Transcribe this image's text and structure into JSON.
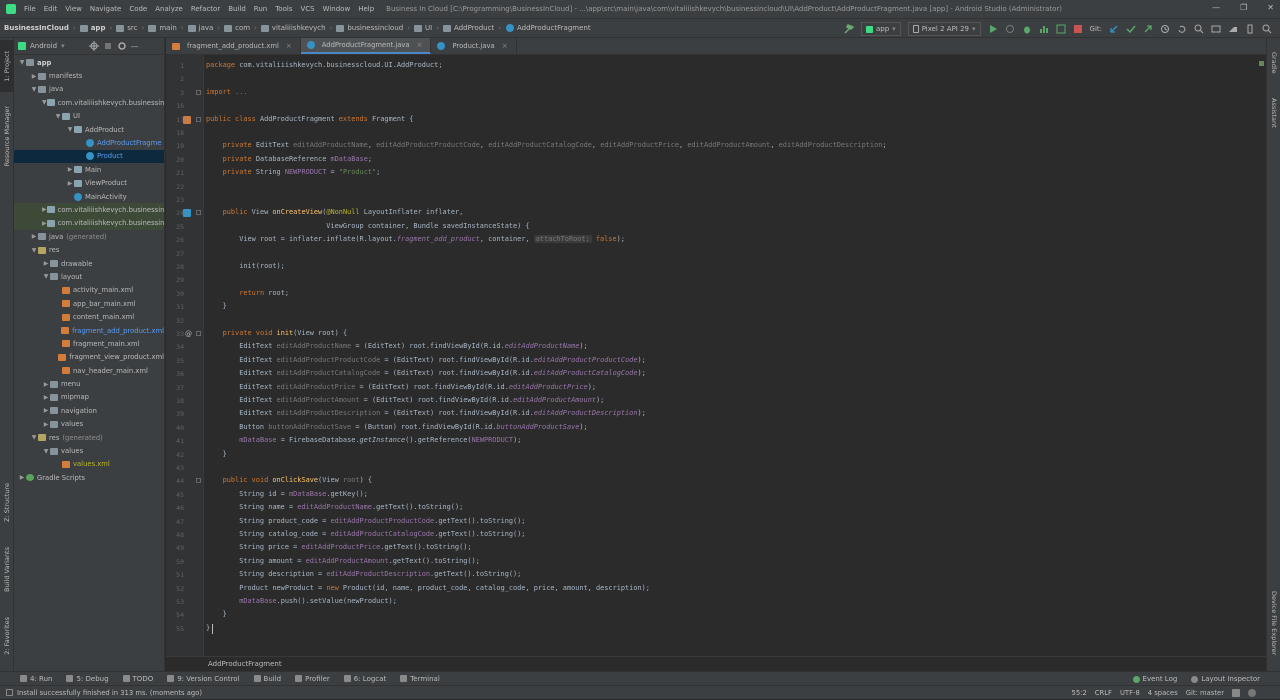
{
  "menubar": {
    "items": [
      "File",
      "Edit",
      "View",
      "Navigate",
      "Code",
      "Analyze",
      "Refactor",
      "Build",
      "Run",
      "Tools",
      "VCS",
      "Window",
      "Help"
    ],
    "window_title": "Business In Cloud [C:\\Programming\\BusinessInCloud] - ...\\app\\src\\main\\java\\com\\vitaliiishkevych\\businessincloud\\UI\\AddProduct\\AddProductFragment.java [app] - Android Studio (Administrator)",
    "win_min": "—",
    "win_max": "❐",
    "win_close": "✕"
  },
  "breadcrumbs": {
    "project": "BusinessInCloud",
    "items": [
      "app",
      "src",
      "main",
      "java",
      "com",
      "vitaliiishkevych",
      "businessincloud",
      "UI",
      "AddProduct",
      "AddProductFragment"
    ]
  },
  "runbar": {
    "config": "app",
    "device": "Pixel 2 API 29",
    "git": "Git:"
  },
  "left_tabs": {
    "project": "1: Project",
    "resource_manager": "Resource Manager",
    "structure": "Z: Structure",
    "build_variants": "Build Variants",
    "favorites": "2: Favorites"
  },
  "right_tabs": {
    "gradle": "Gradle",
    "assistant": "Assistant",
    "device_explorer": "Device File Explorer"
  },
  "project_panel": {
    "view_mode": "Android",
    "tree": [
      {
        "label": "app",
        "level": 0,
        "arrow": "▼",
        "icon": "folder",
        "bold": true
      },
      {
        "label": "manifests",
        "level": 1,
        "arrow": "▶",
        "icon": "folder"
      },
      {
        "label": "java",
        "level": 1,
        "arrow": "▼",
        "icon": "folder"
      },
      {
        "label": "com.vitaliiishkevych.businessinc",
        "level": 2,
        "arrow": "▼",
        "icon": "pkg"
      },
      {
        "label": "UI",
        "level": 3,
        "arrow": "▼",
        "icon": "pkg"
      },
      {
        "label": "AddProduct",
        "level": 4,
        "arrow": "▼",
        "icon": "pkg"
      },
      {
        "label": "AddProductFragme",
        "level": 5,
        "arrow": "",
        "icon": "cls",
        "color": "blue"
      },
      {
        "label": "Product",
        "level": 5,
        "arrow": "",
        "icon": "cls",
        "color": "blue",
        "selected": true
      },
      {
        "label": "Main",
        "level": 4,
        "arrow": "▶",
        "icon": "pkg"
      },
      {
        "label": "ViewProduct",
        "level": 4,
        "arrow": "▶",
        "icon": "pkg"
      },
      {
        "label": "MainActivity",
        "level": 4,
        "arrow": "",
        "icon": "cls"
      },
      {
        "label": "com.vitaliiishkevych.businessinc",
        "level": 2,
        "arrow": "▶",
        "icon": "pkg",
        "highlight": true,
        "suffix": "(androidTest)"
      },
      {
        "label": "com.vitaliiishkevych.businessinc",
        "level": 2,
        "arrow": "▶",
        "icon": "pkg",
        "highlight": true,
        "suffix": "(test)"
      },
      {
        "label": "java",
        "level": 1,
        "arrow": "▶",
        "icon": "folder",
        "suffix": "(generated)"
      },
      {
        "label": "res",
        "level": 1,
        "arrow": "▼",
        "icon": "res"
      },
      {
        "label": "drawable",
        "level": 2,
        "arrow": "▶",
        "icon": "folder"
      },
      {
        "label": "layout",
        "level": 2,
        "arrow": "▼",
        "icon": "folder"
      },
      {
        "label": "activity_main.xml",
        "level": 3,
        "arrow": "",
        "icon": "xml"
      },
      {
        "label": "app_bar_main.xml",
        "level": 3,
        "arrow": "",
        "icon": "xml"
      },
      {
        "label": "content_main.xml",
        "level": 3,
        "arrow": "",
        "icon": "xml"
      },
      {
        "label": "fragment_add_product.xml",
        "level": 3,
        "arrow": "",
        "icon": "xml",
        "color": "blue"
      },
      {
        "label": "fragment_main.xml",
        "level": 3,
        "arrow": "",
        "icon": "xml"
      },
      {
        "label": "fragment_view_product.xml",
        "level": 3,
        "arrow": "",
        "icon": "xml"
      },
      {
        "label": "nav_header_main.xml",
        "level": 3,
        "arrow": "",
        "icon": "xml"
      },
      {
        "label": "menu",
        "level": 2,
        "arrow": "▶",
        "icon": "folder"
      },
      {
        "label": "mipmap",
        "level": 2,
        "arrow": "▶",
        "icon": "folder"
      },
      {
        "label": "navigation",
        "level": 2,
        "arrow": "▶",
        "icon": "folder"
      },
      {
        "label": "values",
        "level": 2,
        "arrow": "▶",
        "icon": "folder"
      },
      {
        "label": "res",
        "level": 1,
        "arrow": "▼",
        "icon": "res",
        "suffix": "(generated)"
      },
      {
        "label": "values",
        "level": 2,
        "arrow": "▼",
        "icon": "folder"
      },
      {
        "label": "values.xml",
        "level": 3,
        "arrow": "",
        "icon": "xml",
        "color": "yellow"
      },
      {
        "label": "Gradle Scripts",
        "level": 0,
        "arrow": "▶",
        "icon": "gradle"
      }
    ]
  },
  "editor_tabs": [
    {
      "label": "fragment_add_product.xml",
      "icon": "xml",
      "active": false
    },
    {
      "label": "AddProductFragment.java",
      "icon": "cls",
      "active": true
    },
    {
      "label": "Product.java",
      "icon": "cls",
      "active": false
    }
  ],
  "code": {
    "line_numbers": [
      "1",
      "2",
      "3",
      "16",
      "17",
      "18",
      "19",
      "20",
      "21",
      "22",
      "23",
      "24",
      "25",
      "26",
      "27",
      "28",
      "29",
      "30",
      "31",
      "32",
      "33",
      "34",
      "35",
      "36",
      "37",
      "38",
      "39",
      "40",
      "41",
      "42",
      "43",
      "44",
      "45",
      "46",
      "47",
      "48",
      "49",
      "50",
      "51",
      "52",
      "53",
      "54",
      "55"
    ],
    "lines": [
      [
        [
          "k",
          "package "
        ],
        [
          "",
          "com.vitaliiishkevych.businesscloud.UI.AddProduct;"
        ]
      ],
      [],
      [
        [
          "k",
          "import "
        ],
        [
          "g",
          "..."
        ]
      ],
      [],
      [
        [
          "k",
          "public class "
        ],
        [
          "",
          "AddProductFragment "
        ],
        [
          "k",
          "extends "
        ],
        [
          "",
          "Fragment {"
        ]
      ],
      [],
      [
        [
          "",
          "    "
        ],
        [
          "k",
          "private "
        ],
        [
          "",
          "EditText "
        ],
        [
          "g",
          "editAddProductName"
        ],
        [
          "",
          ", "
        ],
        [
          "g",
          "editAddProductProductCode"
        ],
        [
          "",
          ", "
        ],
        [
          "g",
          "editAddProductCatalogCode"
        ],
        [
          "",
          ", "
        ],
        [
          "g",
          "editAddProductPrice"
        ],
        [
          "",
          ", "
        ],
        [
          "g",
          "editAddProductAmount"
        ],
        [
          "",
          ", "
        ],
        [
          "g",
          "editAddProductDescription"
        ],
        [
          "",
          ";"
        ]
      ],
      [
        [
          "",
          "    "
        ],
        [
          "k",
          "private "
        ],
        [
          "",
          "DatabaseReference "
        ],
        [
          "f",
          "mDataBase"
        ],
        [
          "",
          ";"
        ]
      ],
      [
        [
          "",
          "    "
        ],
        [
          "k",
          "private "
        ],
        [
          "",
          "String "
        ],
        [
          "f",
          "NEWPRODUCT"
        ],
        [
          "",
          " = "
        ],
        [
          "s",
          "\"Product\""
        ],
        [
          "",
          ";"
        ]
      ],
      [],
      [],
      [
        [
          "",
          "    "
        ],
        [
          "k",
          "public "
        ],
        [
          "",
          "View "
        ],
        [
          "m",
          "onCreateView"
        ],
        [
          "",
          "("
        ],
        [
          "a",
          "@NonNull "
        ],
        [
          "",
          "LayoutInflater inflater,"
        ]
      ],
      [
        [
          "",
          "                             ViewGroup container, Bundle savedInstanceState) {"
        ]
      ],
      [
        [
          "",
          "        View root = inflater.inflate(R.layout."
        ],
        [
          "fi",
          "fragment_add_product"
        ],
        [
          "",
          ", container, "
        ],
        [
          "hint",
          "attachToRoot:"
        ],
        [
          "",
          " "
        ],
        [
          "k",
          "false"
        ],
        [
          "",
          ");"
        ]
      ],
      [],
      [
        [
          "",
          "        init(root);"
        ]
      ],
      [],
      [
        [
          "",
          "        "
        ],
        [
          "k",
          "return "
        ],
        [
          "",
          "root;"
        ]
      ],
      [
        [
          "",
          "    }"
        ]
      ],
      [],
      [
        [
          "",
          "    "
        ],
        [
          "k",
          "private void "
        ],
        [
          "m",
          "init"
        ],
        [
          "",
          "(View root) {"
        ]
      ],
      [
        [
          "",
          "        EditText "
        ],
        [
          "g",
          "editAddProductName"
        ],
        [
          "",
          " = (EditText) root.findViewById(R.id."
        ],
        [
          "fi",
          "editAddProductName"
        ],
        [
          "",
          ");"
        ]
      ],
      [
        [
          "",
          "        EditText "
        ],
        [
          "g",
          "editAddProductProductCode"
        ],
        [
          "",
          " = (EditText) root.findViewById(R.id."
        ],
        [
          "fi",
          "editAddProductProductCode"
        ],
        [
          "",
          ");"
        ]
      ],
      [
        [
          "",
          "        EditText "
        ],
        [
          "g",
          "editAddProductCatalogCode"
        ],
        [
          "",
          " = (EditText) root.findViewById(R.id."
        ],
        [
          "fi",
          "editAddProductCatalogCode"
        ],
        [
          "",
          ");"
        ]
      ],
      [
        [
          "",
          "        EditText "
        ],
        [
          "g",
          "editAddProductPrice"
        ],
        [
          "",
          " = (EditText) root.findViewById(R.id."
        ],
        [
          "fi",
          "editAddProductPrice"
        ],
        [
          "",
          ");"
        ]
      ],
      [
        [
          "",
          "        EditText "
        ],
        [
          "g",
          "editAddProductAmount"
        ],
        [
          "",
          " = (EditText) root.findViewById(R.id."
        ],
        [
          "fi",
          "editAddProductAmount"
        ],
        [
          "",
          ");"
        ]
      ],
      [
        [
          "",
          "        EditText "
        ],
        [
          "g",
          "editAddProductDescription"
        ],
        [
          "",
          " = (EditText) root.findViewById(R.id."
        ],
        [
          "fi",
          "editAddProductDescription"
        ],
        [
          "",
          ");"
        ]
      ],
      [
        [
          "",
          "        Button "
        ],
        [
          "g",
          "buttonAddProductSave"
        ],
        [
          "",
          " = (Button) root.findViewById(R.id."
        ],
        [
          "fi",
          "buttonAddProductSave"
        ],
        [
          "",
          ");"
        ]
      ],
      [
        [
          "",
          "        "
        ],
        [
          "f",
          "mDataBase"
        ],
        [
          "",
          " = FirebaseDatabase."
        ],
        [
          "it",
          "getInstance"
        ],
        [
          "",
          "().getReference("
        ],
        [
          "f",
          "NEWPRODUCT"
        ],
        [
          "",
          ");"
        ]
      ],
      [
        [
          "",
          "    }"
        ]
      ],
      [],
      [
        [
          "",
          "    "
        ],
        [
          "k",
          "public void "
        ],
        [
          "m",
          "onClickSave"
        ],
        [
          "",
          "(View "
        ],
        [
          "g",
          "root"
        ],
        [
          "",
          ") {"
        ]
      ],
      [
        [
          "",
          "        String id = "
        ],
        [
          "f",
          "mDataBase"
        ],
        [
          "",
          ".getKey();"
        ]
      ],
      [
        [
          "",
          "        String name = "
        ],
        [
          "f",
          "editAddProductName"
        ],
        [
          "",
          ".getText().toString();"
        ]
      ],
      [
        [
          "",
          "        String product_code = "
        ],
        [
          "f",
          "editAddProductProductCode"
        ],
        [
          "",
          ".getText().toString();"
        ]
      ],
      [
        [
          "",
          "        String catalog_code = "
        ],
        [
          "f",
          "editAddProductCatalogCode"
        ],
        [
          "",
          ".getText().toString();"
        ]
      ],
      [
        [
          "",
          "        String price = "
        ],
        [
          "f",
          "editAddProductPrice"
        ],
        [
          "",
          ".getText().toString();"
        ]
      ],
      [
        [
          "",
          "        String amount = "
        ],
        [
          "f",
          "editAddProductAmount"
        ],
        [
          "",
          ".getText().toString();"
        ]
      ],
      [
        [
          "",
          "        String description = "
        ],
        [
          "f",
          "editAddProductDescription"
        ],
        [
          "",
          ".getText().toString();"
        ]
      ],
      [
        [
          "",
          "        Product newProduct = "
        ],
        [
          "k",
          "new "
        ],
        [
          "",
          "Product(id, name, product_code, catalog_code, price, amount, description);"
        ]
      ],
      [
        [
          "",
          "        "
        ],
        [
          "f",
          "mDataBase"
        ],
        [
          "",
          ".push().setValue(newProduct);"
        ]
      ],
      [
        [
          "",
          "    }"
        ]
      ],
      [
        [
          "",
          "}"
        ]
      ]
    ]
  },
  "editor_breadcrumb": "AddProductFragment",
  "tool_windows": {
    "left": [
      {
        "label": "4: Run",
        "underline": "4"
      },
      {
        "label": "5: Debug",
        "underline": "5"
      },
      {
        "label": "TODO"
      },
      {
        "label": "9: Version Control"
      },
      {
        "label": "Build"
      },
      {
        "label": "Profiler"
      },
      {
        "label": "6: Logcat"
      },
      {
        "label": "Terminal"
      }
    ],
    "right": [
      {
        "label": "Event Log"
      },
      {
        "label": "Layout Inspector"
      }
    ]
  },
  "status": {
    "message": "Install successfully finished in 313 ms. (moments ago)",
    "position": "55:2",
    "line_sep": "CRLF",
    "encoding": "UTF-8",
    "indent": "4 spaces",
    "vcs": "Git: master"
  },
  "colors": {
    "keyword": "#cc7832",
    "field": "#9876aa",
    "string": "#6a8759",
    "method": "#ffc66d",
    "annotation": "#bbb529",
    "unused": "#787878",
    "accent": "#4a88c7"
  }
}
